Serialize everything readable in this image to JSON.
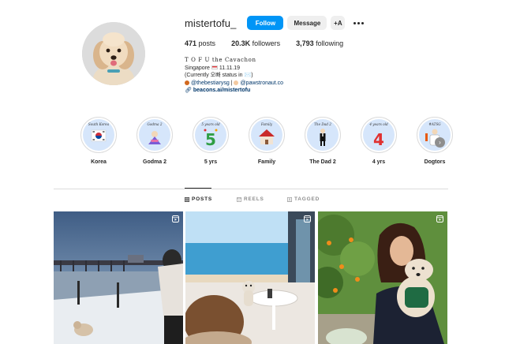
{
  "profile": {
    "username": "mistertofu_",
    "follow_label": "Follow",
    "message_label": "Message",
    "suggest_icon": "+A",
    "stats": {
      "posts_count": "471",
      "posts_label": "posts",
      "followers_count": "20.3K",
      "followers_label": "followers",
      "following_count": "3,793",
      "following_label": "following"
    },
    "bio": {
      "name": "T O F U  the Cavachon",
      "line2": "Singapore",
      "line2_suffix": " 11.11.19",
      "line3": "(Currently 오빠 status in ✉️)",
      "line4_a": "@thebestiarysg",
      "line4_sep": " | ",
      "line4_b": "@pawstronaut.co",
      "link": "beacons.ai/mistertofu"
    }
  },
  "highlights": [
    {
      "label": "Korea",
      "caption": "South Korea",
      "icon": "korea-flag-icon"
    },
    {
      "label": "Godma 2",
      "caption": "Godma 2",
      "icon": "hanbok-icon"
    },
    {
      "label": "5 yrs",
      "caption": "5 years old",
      "icon": "number-5-icon"
    },
    {
      "label": "Family",
      "caption": "Family",
      "icon": "house-icon"
    },
    {
      "label": "The Dad 2",
      "caption": "The Dad 2",
      "icon": "tuxedo-icon"
    },
    {
      "label": "4 yrs",
      "caption": "4 years old",
      "icon": "number-4-icon"
    },
    {
      "label": "Dogtors",
      "caption": "#ATSG",
      "icon": "doctor-icon"
    }
  ],
  "tabs": [
    {
      "label": "POSTS",
      "icon": "grid-icon",
      "active": true
    },
    {
      "label": "REELS",
      "icon": "reels-icon",
      "active": false
    },
    {
      "label": "TAGGED",
      "icon": "tagged-icon",
      "active": false
    }
  ],
  "posts": [
    {
      "type": "reel",
      "scene": "winter-river-bridge"
    },
    {
      "type": "reel",
      "scene": "seaside-cafe-window"
    },
    {
      "type": "reel",
      "scene": "woman-holding-dog-garden"
    }
  ],
  "colors": {
    "accent": "#0095f6",
    "text": "#262626",
    "muted": "#8e8e8e",
    "link": "#00376b",
    "highlight_bg": "#d6e6fb"
  }
}
